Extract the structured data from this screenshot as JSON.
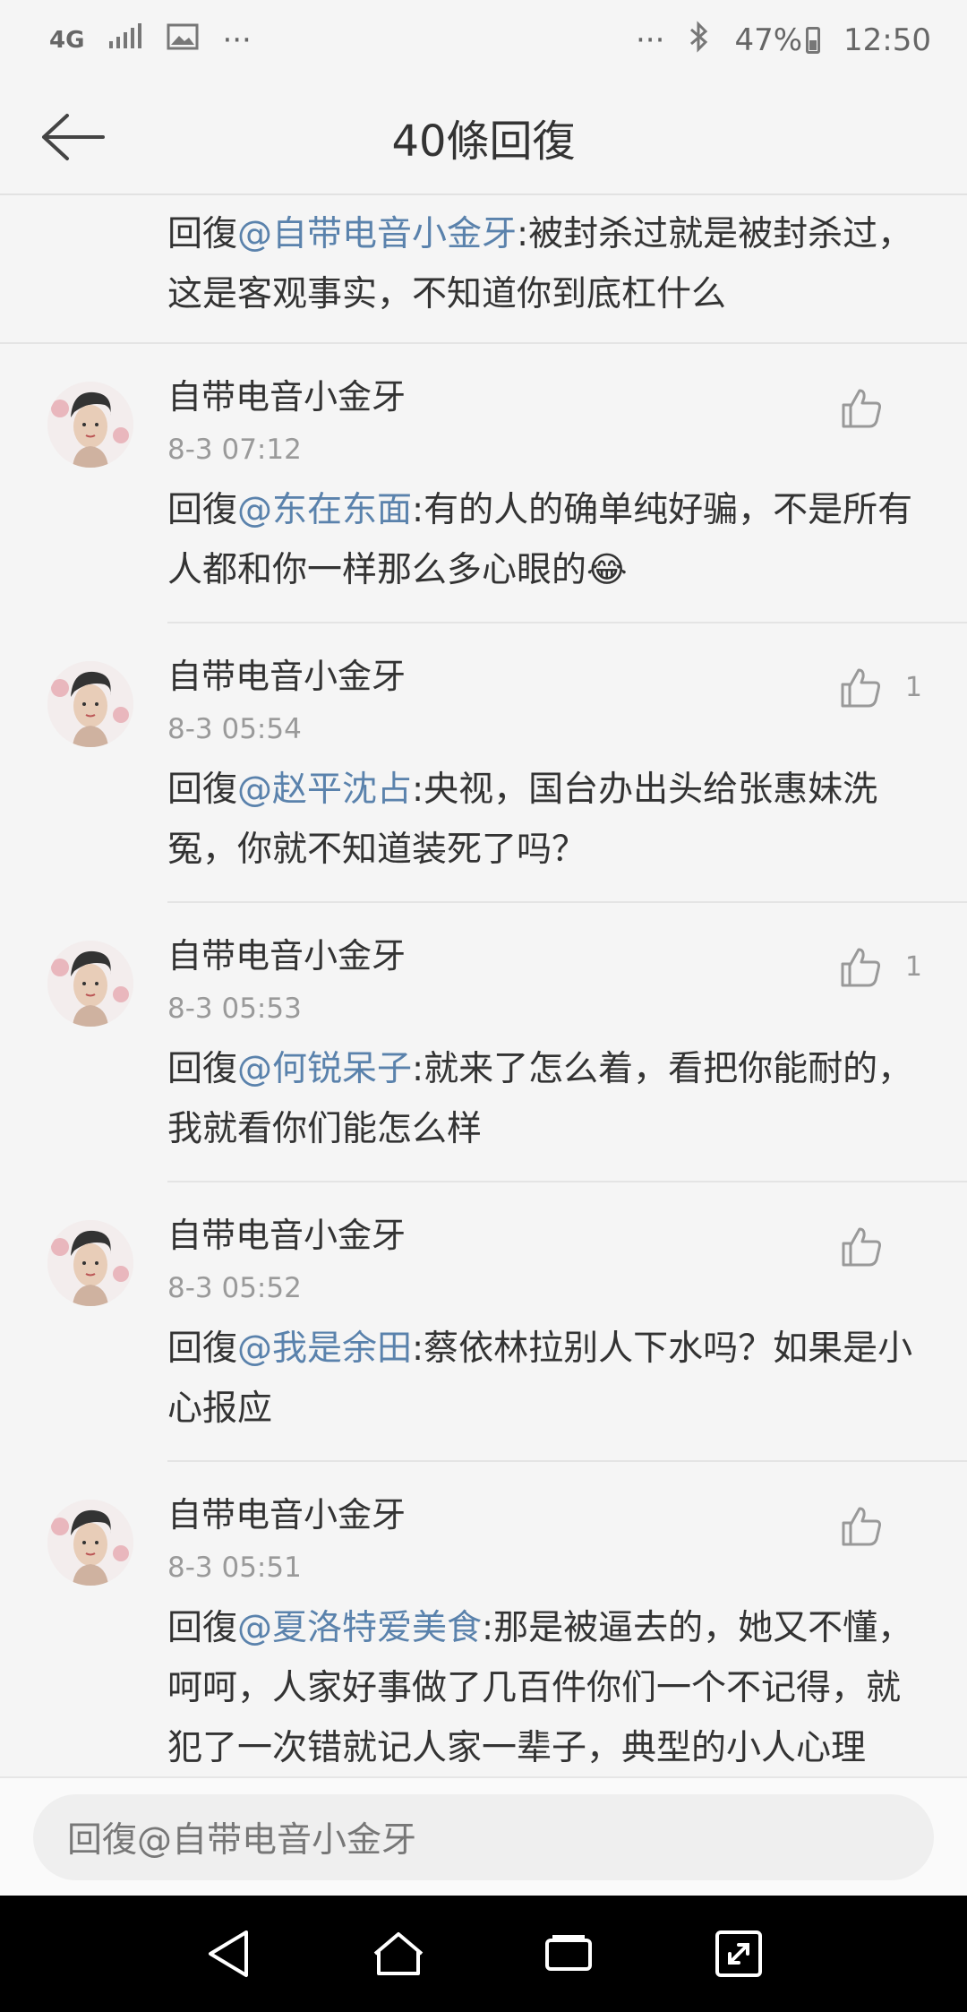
{
  "status_bar": {
    "network": "4G",
    "dots_left": "···",
    "dots_right": "···",
    "battery": "47%",
    "time": "12:50"
  },
  "header": {
    "title": "40條回復"
  },
  "top_snippet": {
    "prefix": "回復",
    "mention": "@自带电音小金牙",
    "text": ":被封杀过就是被封杀过，这是客观事实，不知道你到底杠什么"
  },
  "comments": [
    {
      "username": "自带电音小金牙",
      "time": "8-3 07:12",
      "prefix": "回復",
      "mention": "@东在东面",
      "text": ":有的人的确单纯好骗，不是所有人都和你一样那么多心眼的😂",
      "likes": ""
    },
    {
      "username": "自带电音小金牙",
      "time": "8-3 05:54",
      "prefix": "回復",
      "mention": "@赵平沈占",
      "text": ":央视，国台办出头给张惠妹洗冤，你就不知道装死了吗？",
      "likes": "1"
    },
    {
      "username": "自带电音小金牙",
      "time": "8-3 05:53",
      "prefix": "回復",
      "mention": "@何锐呆子",
      "text": ":就来了怎么着，看把你能耐的，我就看你们能怎么样",
      "likes": "1"
    },
    {
      "username": "自带电音小金牙",
      "time": "8-3 05:52",
      "prefix": "回復",
      "mention": "@我是余田",
      "text": ":蔡依林拉别人下水吗？如果是小心报应",
      "likes": ""
    },
    {
      "username": "自带电音小金牙",
      "time": "8-3 05:51",
      "prefix": "回復",
      "mention": "@夏洛特爱美食",
      "text": ":那是被逼去的，她又不懂，呵呵，人家好事做了几百件你们一个不记得，就犯了一次错就记人家一辈子，典型的小人心理",
      "likes": ""
    }
  ],
  "reply_bar": {
    "placeholder": "回復@自带电音小金牙"
  },
  "colors": {
    "mention": "#5a82ac",
    "background": "#f5f5f5"
  }
}
